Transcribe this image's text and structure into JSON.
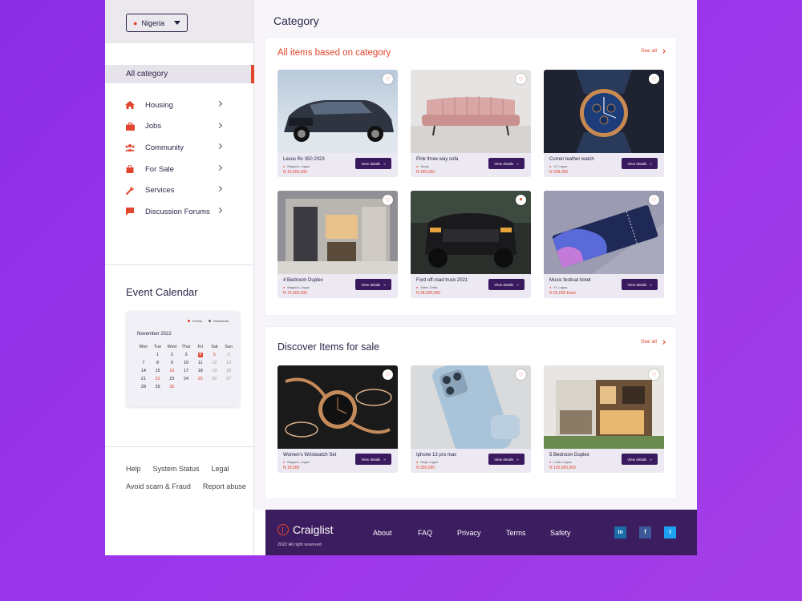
{
  "sidebar": {
    "country": "Nigeria",
    "all_category": "All category",
    "categories": [
      {
        "label": "Housing"
      },
      {
        "label": "Jobs"
      },
      {
        "label": "Community"
      },
      {
        "label": "For Sale"
      },
      {
        "label": "Services"
      },
      {
        "label": "Discussion Forums"
      }
    ],
    "event_calendar": {
      "title": "Event Calendar",
      "legend_events": "Events",
      "legend_weekends": "Weekends",
      "month": "November 2022",
      "days": [
        "Mon",
        "Tue",
        "Wed",
        "Thur",
        "Fri",
        "Sat",
        "Sun"
      ]
    },
    "links": {
      "help": "Help",
      "system_status": "System Status",
      "legal": "Legal",
      "avoid_scam": "Avoid scam & Fraud",
      "report_abuse": "Report abuse"
    }
  },
  "main": {
    "title": "Category",
    "section1": {
      "title": "All items based on category",
      "see_all": "See all",
      "items": [
        {
          "name": "Lexus Rx 350 2023",
          "location": "Magodo, Lagos",
          "price": "N 15,000,000",
          "button": "View details"
        },
        {
          "name": "Pink three way sofa",
          "location": "Abuja",
          "price": "N 180,000",
          "button": "View details"
        },
        {
          "name": "Curren leather watch",
          "location": "VI, Lagos",
          "price": "N 208,000",
          "button": "View details"
        },
        {
          "name": "4 Bedroom Duplex",
          "location": "Magodo, Lagos",
          "price": "N 75,000,000",
          "button": "View details"
        },
        {
          "name": "Ford off-road truck 2021",
          "location": "Warri, Delta",
          "price": "N 28,000,000",
          "button": "View details"
        },
        {
          "name": "Music festival ticket",
          "location": "VI, Lagos",
          "price": "N 25,000 Each",
          "button": "View details"
        }
      ]
    },
    "section2": {
      "title": "Discover Items for sale",
      "see_all": "See all",
      "items": [
        {
          "name": "Women's Wristwatch Set",
          "location": "Magodo, Lagos",
          "price": "N 18,000",
          "button": "View details"
        },
        {
          "name": "Iphone 13 pro max",
          "location": "Ikeja, Lagos",
          "price": "N 350,000",
          "button": "View details"
        },
        {
          "name": "5 Bedroom Duplex",
          "location": "Lekki, Lagos",
          "price": "N 120,000,000",
          "button": "View details"
        }
      ]
    }
  },
  "footer": {
    "brand": "Craiglist",
    "copyright": "2022 All right reserved",
    "nav": [
      "About",
      "FAQ",
      "Privacy",
      "Terms",
      "Safety"
    ],
    "social": {
      "linkedin": "in",
      "facebook": "f",
      "twitter": "t"
    }
  },
  "colors": {
    "accent": "#e0452d",
    "brand_dark": "#3c1d5f",
    "button": "#3a1a5e",
    "background": "#9b35ea"
  }
}
